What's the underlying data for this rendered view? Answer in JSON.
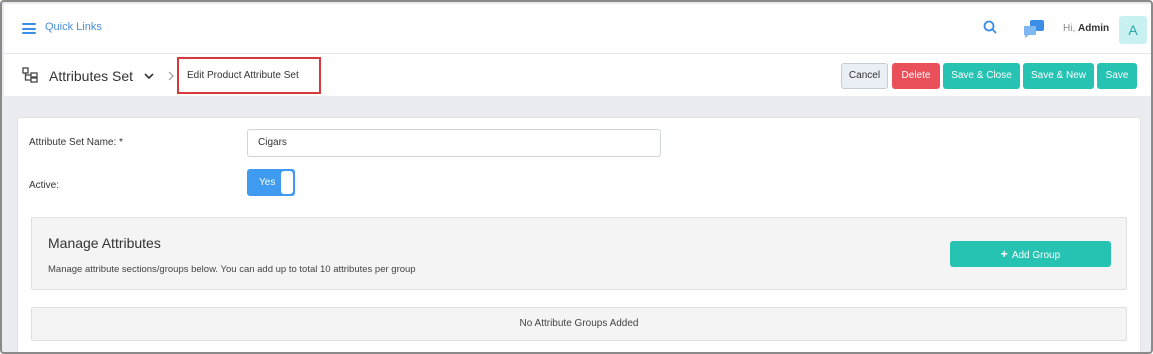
{
  "topbar": {
    "quick_links_label": "Quick Links",
    "greeting_prefix": "Hi,",
    "user_name": "Admin",
    "avatar_initial": "A",
    "icons": [
      "menu-icon",
      "search-icon",
      "chat-icon"
    ]
  },
  "titlebar": {
    "title": "Attributes Set",
    "breadcrumb_current": "Edit Product Attribute Set",
    "buttons": {
      "cancel": "Cancel",
      "delete": "Delete",
      "save_close": "Save & Close",
      "save_new": "Save & New",
      "save": "Save"
    }
  },
  "form": {
    "name_label": "Attribute Set Name: *",
    "name_value": "Cigars",
    "active_label": "Active:",
    "active_value": "Yes"
  },
  "manage": {
    "title": "Manage Attributes",
    "description": "Manage attribute sections/groups below. You can add up to total 10 attributes per group",
    "add_group_label": "Add Group",
    "empty_message": "No Attribute Groups Added"
  },
  "colors": {
    "accent_teal": "#26c2b2",
    "delete_red": "#e9505a",
    "toggle_blue": "#3f9bf0",
    "link_blue": "#4a8fd8",
    "highlight_red": "#d9393e"
  }
}
